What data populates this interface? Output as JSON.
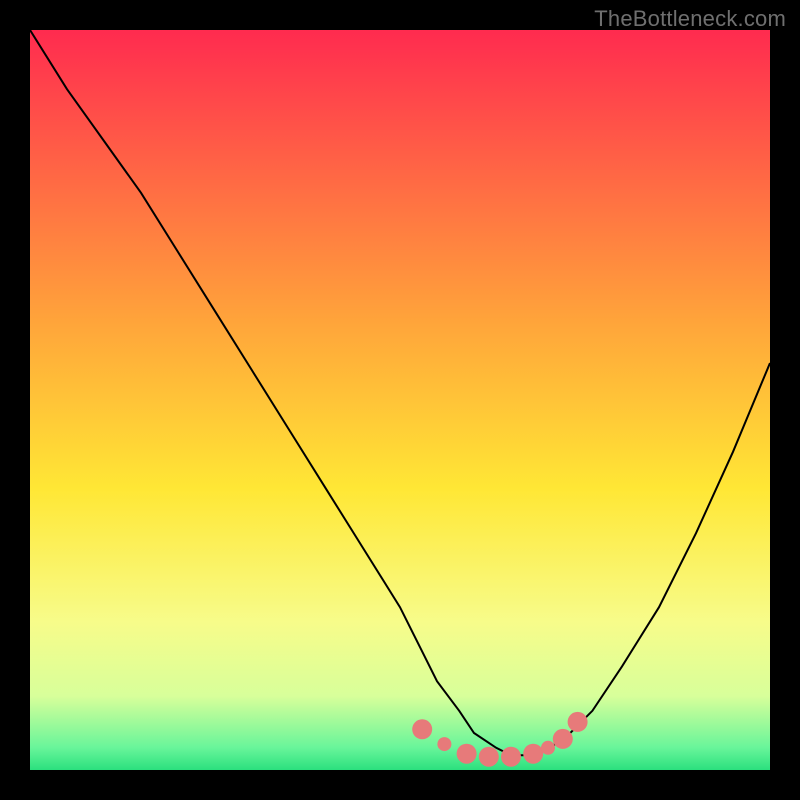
{
  "watermark": "TheBottleneck.com",
  "chart_data": {
    "type": "line",
    "title": "",
    "xlabel": "",
    "ylabel": "",
    "xlim": [
      0,
      100
    ],
    "ylim": [
      0,
      100
    ],
    "grid": false,
    "legend": false,
    "background_gradient": {
      "stops": [
        {
          "offset": 0.0,
          "color": "#ff2b4f"
        },
        {
          "offset": 0.4,
          "color": "#ffa63a"
        },
        {
          "offset": 0.62,
          "color": "#ffe735"
        },
        {
          "offset": 0.8,
          "color": "#f7fc8a"
        },
        {
          "offset": 0.9,
          "color": "#d8ff9a"
        },
        {
          "offset": 0.97,
          "color": "#68f59a"
        },
        {
          "offset": 1.0,
          "color": "#2be07e"
        }
      ]
    },
    "series": [
      {
        "name": "bottleneck-curve",
        "color": "#000000",
        "x": [
          0,
          5,
          10,
          15,
          20,
          25,
          30,
          35,
          40,
          45,
          50,
          53,
          55,
          58,
          60,
          63,
          65,
          68,
          72,
          76,
          80,
          85,
          90,
          95,
          100
        ],
        "values": [
          100,
          92,
          85,
          78,
          70,
          62,
          54,
          46,
          38,
          30,
          22,
          16,
          12,
          8,
          5,
          3,
          2,
          2,
          4,
          8,
          14,
          22,
          32,
          43,
          55
        ]
      }
    ],
    "markers": {
      "name": "bottom-dots",
      "color": "#e77a7a",
      "radius_main": 10,
      "radius_small": 7,
      "points": [
        {
          "x": 53,
          "y": 5.5
        },
        {
          "x": 56,
          "y": 3.5,
          "small": true
        },
        {
          "x": 59,
          "y": 2.2
        },
        {
          "x": 62,
          "y": 1.8
        },
        {
          "x": 65,
          "y": 1.8
        },
        {
          "x": 68,
          "y": 2.2
        },
        {
          "x": 70,
          "y": 3.0,
          "small": true
        },
        {
          "x": 72,
          "y": 4.2
        },
        {
          "x": 74,
          "y": 6.5
        }
      ]
    }
  }
}
